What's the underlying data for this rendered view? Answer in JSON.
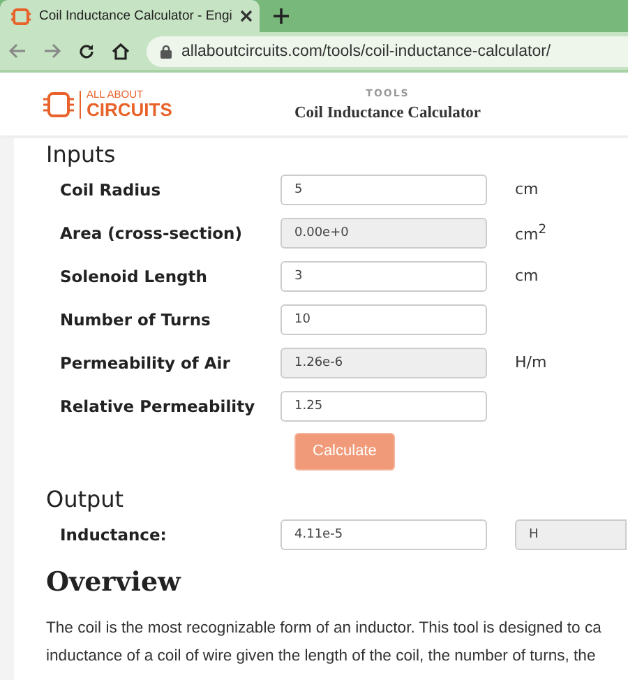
{
  "browser": {
    "tab_title": "Coil Inductance Calculator - Engi",
    "url": "allaboutcircuits.com/tools/coil-inductance-calculator/"
  },
  "header": {
    "logo_top": "ALL ABOUT",
    "logo_bottom": "CIRCUITS",
    "section": "TOOLS",
    "title": "Coil Inductance Calculator"
  },
  "inputs": {
    "heading": "Inputs",
    "fields": [
      {
        "label": "Coil Radius",
        "value": "5",
        "unit": "cm",
        "kind": "input"
      },
      {
        "label": "Area (cross-section)",
        "value": "0.00e+0",
        "unit": "cm$^{2}$",
        "kind": "readonly"
      },
      {
        "label": "Solenoid Length",
        "value": "3",
        "unit": "cm",
        "kind": "input"
      },
      {
        "label": "Number of Turns",
        "value": "10",
        "kind": "input"
      },
      {
        "label": "Permeability of Air",
        "value": "1.26e-6",
        "unit": "H/m",
        "kind": "readonly"
      },
      {
        "label": "Relative Permeability",
        "value": "1.25",
        "kind": "input"
      }
    ],
    "button": "Calculate"
  },
  "output": {
    "heading": "Output",
    "label": "Inductance:",
    "value": "4.11e-5",
    "unit": "H"
  },
  "overview": {
    "heading": "Overview",
    "lines": [
      "The coil is the most recognizable form of an inductor. This tool is designed to ca",
      "inductance of a coil of wire given the length of the coil, the number of turns, the"
    ]
  }
}
